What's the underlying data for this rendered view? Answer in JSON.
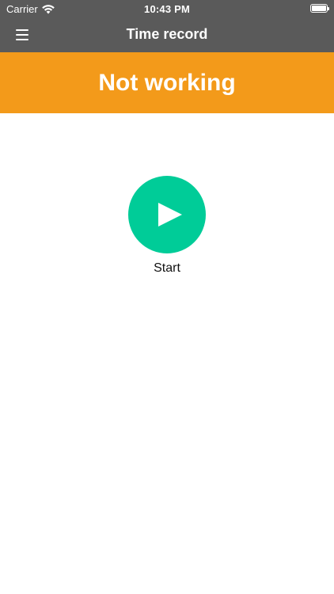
{
  "status_bar": {
    "carrier": "Carrier",
    "time": "10:43 PM",
    "wifi_icon": "wifi-icon",
    "battery_icon": "battery-icon"
  },
  "nav_bar": {
    "menu_icon": "hamburger-menu-icon",
    "title": "Time record",
    "background_color": "#5a5a5a"
  },
  "status_banner": {
    "text": "Not working",
    "background_color": "#f39a1a"
  },
  "start_action": {
    "icon": "play-icon",
    "label": "Start",
    "button_color": "#00cc98"
  }
}
